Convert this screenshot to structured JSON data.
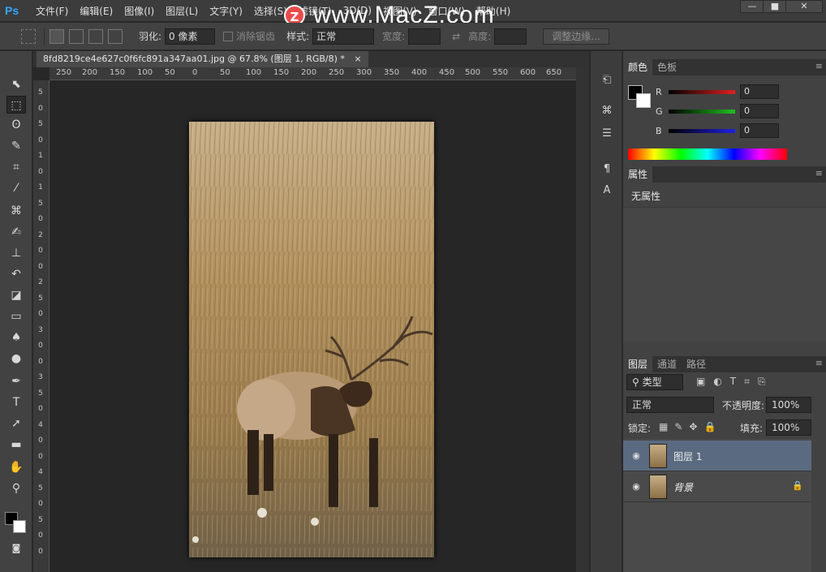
{
  "menubar": {
    "logo": "Ps",
    "items": [
      "文件(F)",
      "编辑(E)",
      "图像(I)",
      "图层(L)",
      "文字(Y)",
      "选择(S)",
      "滤镜(T)",
      "3D(D)",
      "视图(V)",
      "窗口(W)",
      "帮助(H)"
    ],
    "watermark_badge": "Z",
    "watermark_text": "www.MacZ.com",
    "window_buttons": [
      "—",
      "■",
      "✕"
    ]
  },
  "options": {
    "feather_label": "羽化:",
    "feather_value": "0 像素",
    "antialias_label": "消除锯齿",
    "style_label": "样式:",
    "style_value": "正常",
    "width_label": "宽度:",
    "height_label": "高度:",
    "refine_edge_button": "调整边缘..."
  },
  "document": {
    "tab_title": "8fd8219ce4e627c0f6fc891a347aa01.jpg @ 67.8% (图层 1, RGB/8) *",
    "tab_close": "×",
    "ruler_top_labels": [
      "250",
      "200",
      "150",
      "100",
      "50",
      "0",
      "50",
      "100",
      "150",
      "200",
      "250",
      "300",
      "350",
      "400",
      "450",
      "500",
      "550",
      "600",
      "650"
    ],
    "ruler_left_labels": [
      "5",
      "0",
      "5",
      "0",
      "1",
      "0",
      "1",
      "5",
      "0",
      "2",
      "0",
      "0",
      "2",
      "5",
      "0",
      "3",
      "0",
      "0",
      "3",
      "5",
      "0",
      "4",
      "0",
      "0",
      "4",
      "5",
      "0",
      "5",
      "0",
      "0"
    ]
  },
  "colors": {
    "panel_tabs": [
      "颜色",
      "色板"
    ],
    "channels": [
      {
        "label": "R",
        "value": "0",
        "color": "#e02020"
      },
      {
        "label": "G",
        "value": "0",
        "color": "#20c020"
      },
      {
        "label": "B",
        "value": "0",
        "color": "#2020e0"
      }
    ],
    "foreground": "#000000",
    "background": "#ffffff"
  },
  "properties": {
    "tab": "属性",
    "empty_text": "无属性"
  },
  "layers": {
    "tabs": [
      "图层",
      "通道",
      "路径"
    ],
    "filter_kind": "类型",
    "blend_mode": "正常",
    "opacity_label": "不透明度:",
    "opacity_value": "100%",
    "lock_label": "锁定:",
    "fill_label": "填充:",
    "fill_value": "100%",
    "items": [
      {
        "name": "图层 1",
        "selected": true
      },
      {
        "name": "背景",
        "selected": false,
        "locked": true
      }
    ]
  },
  "tools": [
    "move-tool",
    "marquee-tool",
    "lasso-tool",
    "quick-select-tool",
    "crop-tool",
    "eyedropper-tool",
    "healing-brush-tool",
    "brush-tool",
    "clone-stamp-tool",
    "history-brush-tool",
    "eraser-tool",
    "gradient-tool",
    "blur-tool",
    "dodge-tool",
    "pen-tool",
    "type-tool",
    "path-select-tool",
    "rectangle-tool",
    "hand-tool",
    "zoom-tool"
  ]
}
